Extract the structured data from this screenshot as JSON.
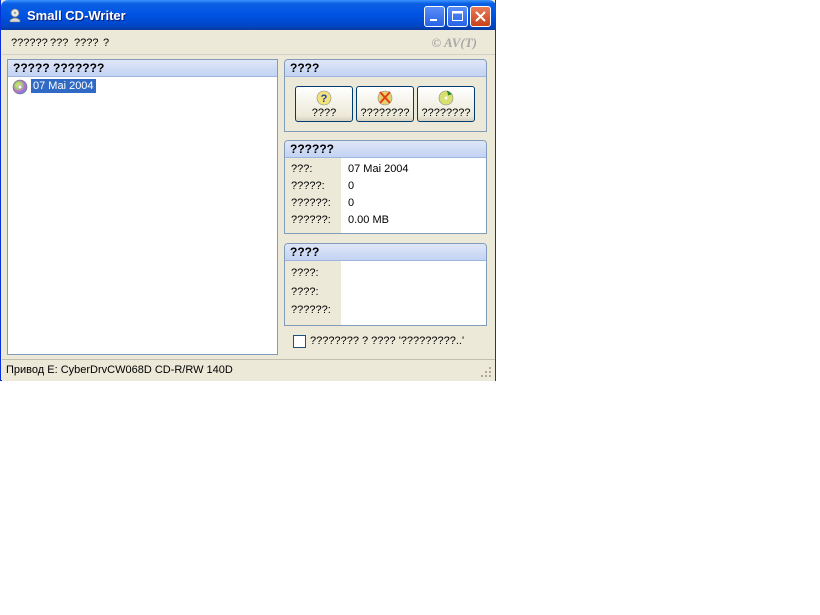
{
  "window": {
    "title": "Small CD-Writer"
  },
  "menu": {
    "items": [
      "??????",
      "???",
      "????",
      "?"
    ],
    "copyright": "© AV(T)"
  },
  "left_panel": {
    "header": "????? ???????",
    "items": [
      {
        "label": "07 Mai 2004",
        "icon": "cd-disc-icon"
      }
    ]
  },
  "actions_panel": {
    "header": "????",
    "buttons": [
      {
        "label": "????",
        "icon": "help-disc-icon"
      },
      {
        "label": "????????",
        "icon": "erase-disc-icon"
      },
      {
        "label": "????????",
        "icon": "burn-disc-icon"
      }
    ]
  },
  "info_panel": {
    "header": "??????",
    "rows": [
      {
        "key": "???:",
        "value": "07 Mai 2004"
      },
      {
        "key": "?????:",
        "value": "0"
      },
      {
        "key": "??????:",
        "value": "0"
      },
      {
        "key": "??????:",
        "value": "0.00 MB"
      }
    ]
  },
  "dest_panel": {
    "header": "????",
    "rows": [
      {
        "key": "????:",
        "value": ""
      },
      {
        "key": "????:",
        "value": ""
      },
      {
        "key": "??????:",
        "value": ""
      }
    ]
  },
  "checkbox": {
    "label": "???????? ? ???? '?????????..'",
    "checked": false
  },
  "status": {
    "text": "Привод  E: CyberDrvCW068D CD-R/RW 140D"
  },
  "colors": {
    "titlebar": "#0054e3",
    "selection": "#316ac5",
    "panel_border": "#7f9db9"
  }
}
